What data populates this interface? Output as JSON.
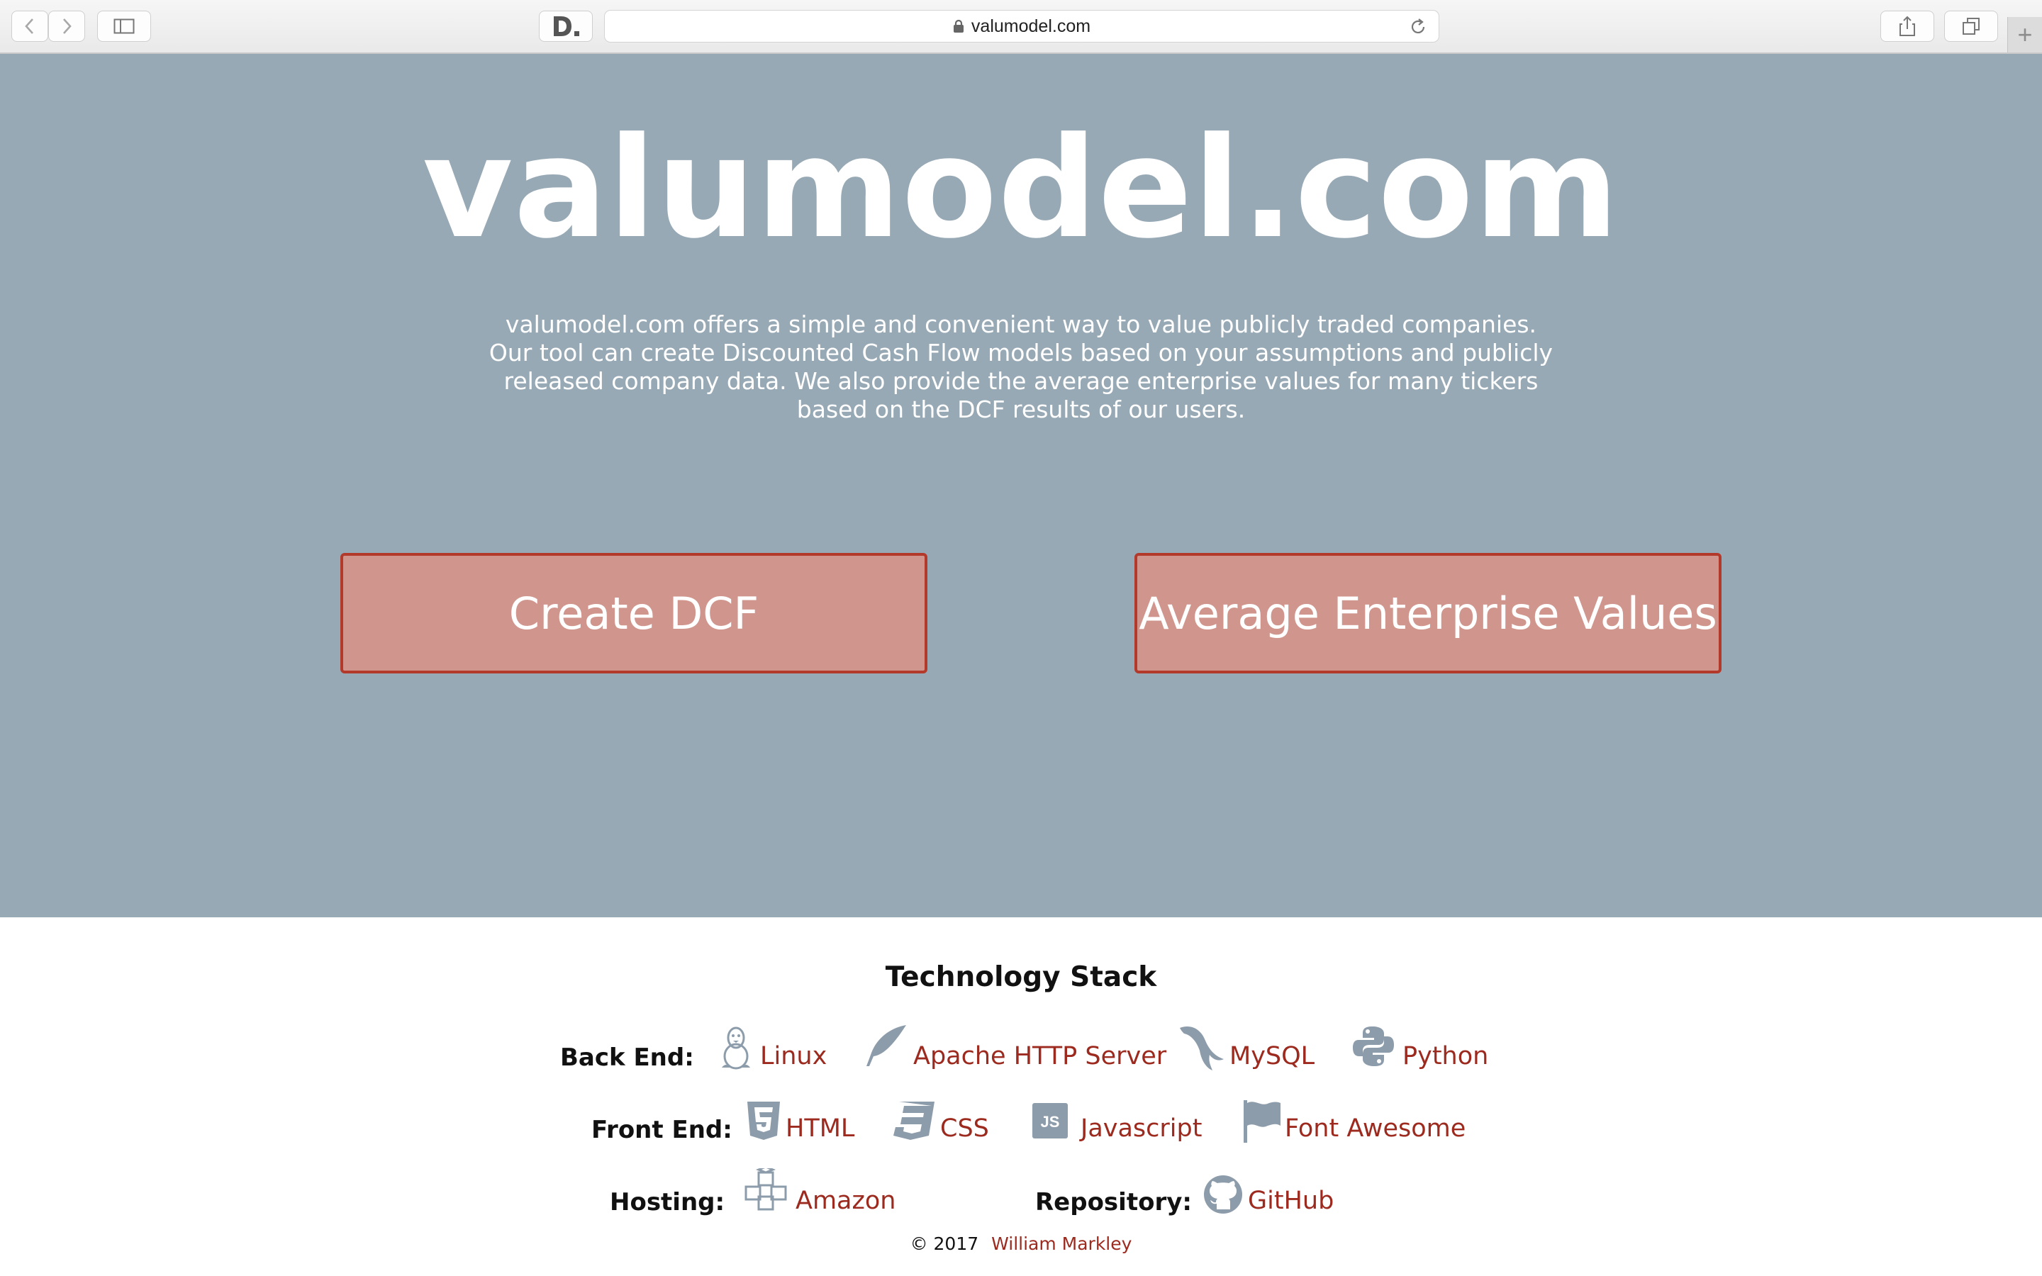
{
  "browser": {
    "url": "valumodel.com"
  },
  "hero": {
    "title": "valumodel.com",
    "description": "valumodel.com offers a simple and convenient way to value publicly traded companies. Our tool can create Discounted Cash Flow models based on your assumptions and publicly released company data. We also provide the average enterprise values for many tickers based on the DCF results of our users.",
    "buttons": {
      "create_dcf": "Create DCF",
      "average_ev": "Average Enterprise Values"
    }
  },
  "footer": {
    "title": "Technology Stack",
    "back_end_label": "Back End:",
    "front_end_label": "Front End:",
    "hosting_label": "Hosting:",
    "repository_label": "Repository:",
    "back_end": [
      "Linux",
      "Apache HTTP Server",
      "MySQL",
      "Python"
    ],
    "front_end": [
      "HTML",
      "CSS",
      "Javascript",
      "Font Awesome"
    ],
    "hosting": "Amazon",
    "repository": "GitHub",
    "copyright": "© 2017",
    "author": "William Markley"
  },
  "colors": {
    "hero_bg": "#98a9b6",
    "button_bg": "#d0968d",
    "button_border": "#b33a2a",
    "link": "#9c2a1e",
    "icon": "#8d9cab"
  },
  "icons": [
    "back-icon",
    "forward-icon",
    "sidebar-icon",
    "extension-icon",
    "lock-icon",
    "reload-icon",
    "share-icon",
    "tabs-icon",
    "linux-icon",
    "feather-icon",
    "mysql-dolphin-icon",
    "python-icon",
    "html5-icon",
    "css3-icon",
    "js-icon",
    "flag-icon",
    "cubes-icon",
    "github-icon"
  ]
}
